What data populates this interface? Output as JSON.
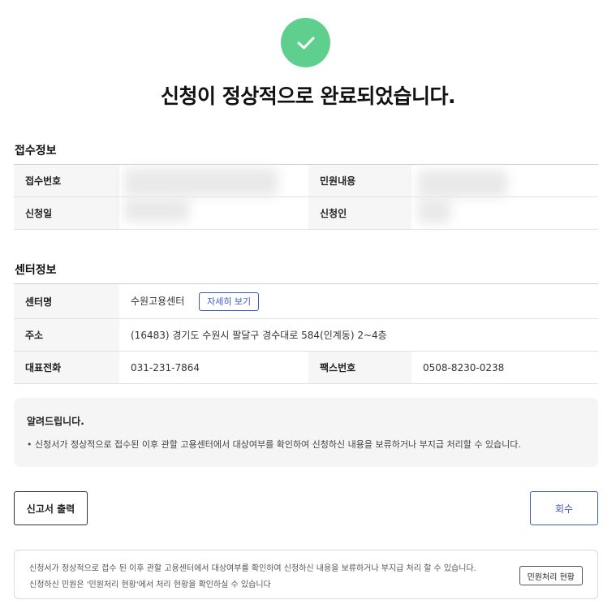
{
  "header": {
    "title": "신청이 정상적으로 완료되었습니다.",
    "success_icon": "check-icon",
    "success_color": "#5fcf8e"
  },
  "receipt": {
    "section_title": "접수정보",
    "receipt_number_label": "접수번호",
    "complaint_content_label": "민원내용",
    "application_date_label": "신청일",
    "applicant_label": "신청인"
  },
  "center": {
    "section_title": "센터정보",
    "name_label": "센터명",
    "name_value": "수원고용센터",
    "detail_button": "자세히 보기",
    "address_label": "주소",
    "address_value": "(16483) 경기도 수원시 팔달구 경수대로 584(인계동) 2~4층",
    "phone_label": "대표전화",
    "phone_value": "031-231-7864",
    "fax_label": "팩스번호",
    "fax_value": "0508-8230-0238"
  },
  "notice": {
    "title": "알려드립니다.",
    "text": "• 신청서가 정상적으로 접수된 이후 관할 고용센터에서 대상여부를 확인하여 신청하신 내용을 보류하거나 부지급 처리할 수 있습니다."
  },
  "actions": {
    "print_label": "신고서 출력",
    "withdraw_label": "회수",
    "accent_color": "#3f5bc7"
  },
  "footer": {
    "line1": "신청서가 정상적으로 접수 된 이후 관할 고용센터에서 대상여부를 확인하여 신청하신 내용을 보류하거나 부지급 처리 할 수 있습니다.",
    "line2": "신청하신 민원은 '민원처리 현황'에서 처리 현황을 확인하실 수 있습니다",
    "status_button": "민원처리 현황"
  }
}
